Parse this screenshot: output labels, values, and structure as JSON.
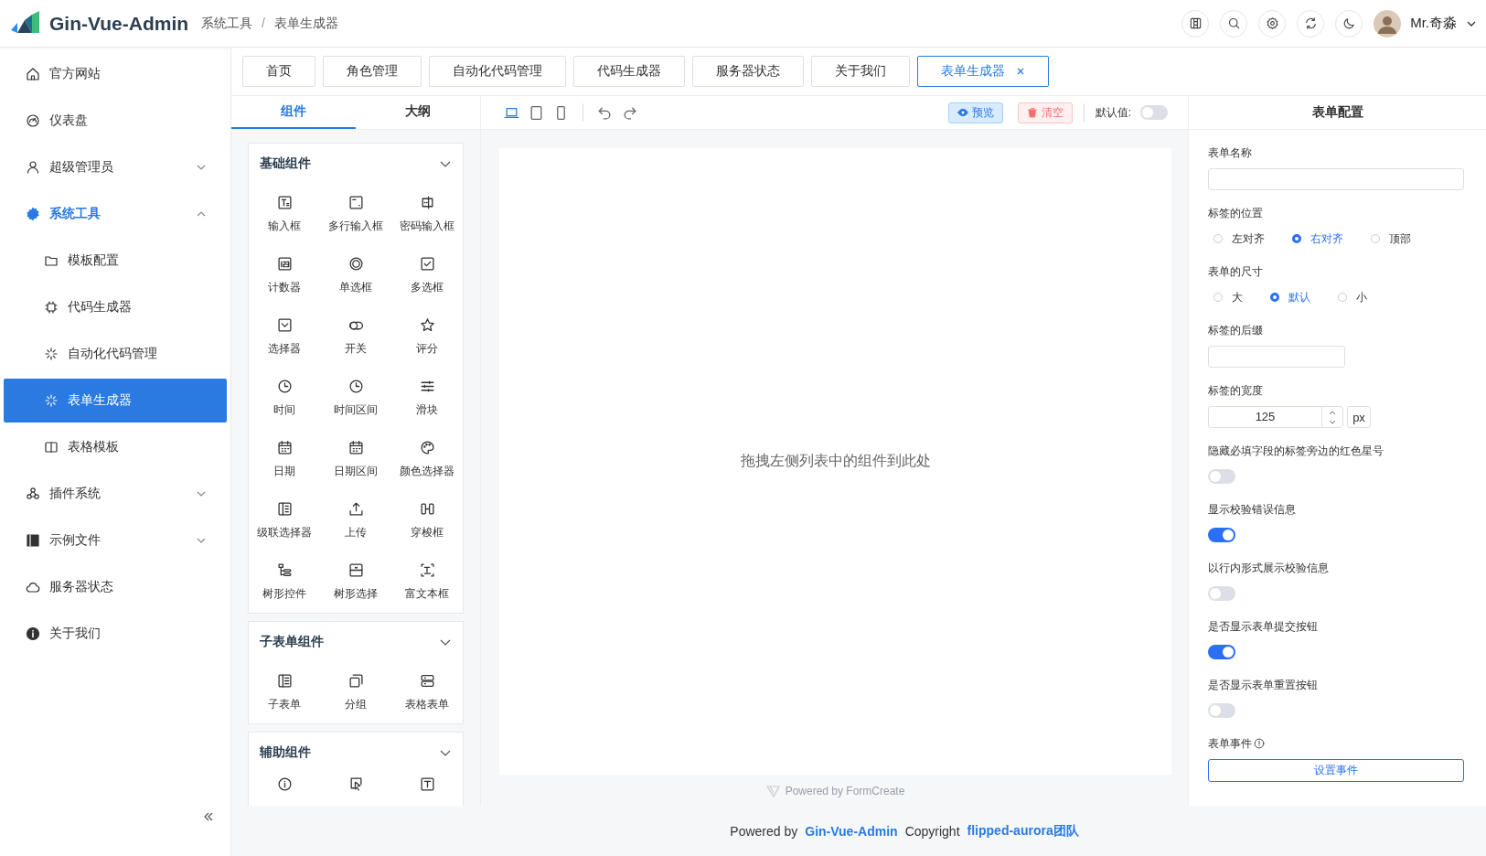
{
  "header": {
    "title": "Gin-Vue-Admin",
    "breadcrumb": [
      "系统工具",
      "表单生成器"
    ],
    "breadcrumb_separator": "/",
    "user_name": "Mr.奇淼"
  },
  "sidebar": {
    "items": [
      {
        "label": "官方网站",
        "selected": false
      },
      {
        "label": "仪表盘",
        "selected": false
      },
      {
        "label": "超级管理员",
        "selected": false,
        "expanded": false
      },
      {
        "label": "系统工具",
        "selected": false,
        "expanded": true,
        "children": [
          {
            "label": "模板配置",
            "selected": false
          },
          {
            "label": "代码生成器",
            "selected": false
          },
          {
            "label": "自动化代码管理",
            "selected": false
          },
          {
            "label": "表单生成器",
            "selected": true
          },
          {
            "label": "表格模板",
            "selected": false
          }
        ]
      },
      {
        "label": "插件系统",
        "selected": false,
        "expanded": false
      },
      {
        "label": "示例文件",
        "selected": false,
        "expanded": false
      },
      {
        "label": "服务器状态",
        "selected": false
      },
      {
        "label": "关于我们",
        "selected": false
      }
    ]
  },
  "tabs": [
    {
      "label": "首页",
      "selected": false
    },
    {
      "label": "角色管理",
      "selected": false
    },
    {
      "label": "自动化代码管理",
      "selected": false
    },
    {
      "label": "代码生成器",
      "selected": false
    },
    {
      "label": "服务器状态",
      "selected": false
    },
    {
      "label": "关于我们",
      "selected": false
    },
    {
      "label": "表单生成器",
      "selected": true,
      "closable": true
    }
  ],
  "builder": {
    "panel_tabs": [
      {
        "label": "组件",
        "selected": true
      },
      {
        "label": "大纲",
        "selected": false
      }
    ],
    "groups": [
      {
        "title": "基础组件",
        "expanded": true,
        "items": [
          {
            "label": "输入框"
          },
          {
            "label": "多行输入框"
          },
          {
            "label": "密码输入框"
          },
          {
            "label": "计数器"
          },
          {
            "label": "单选框"
          },
          {
            "label": "多选框"
          },
          {
            "label": "选择器"
          },
          {
            "label": "开关"
          },
          {
            "label": "评分"
          },
          {
            "label": "时间"
          },
          {
            "label": "时间区间"
          },
          {
            "label": "滑块"
          },
          {
            "label": "日期"
          },
          {
            "label": "日期区间"
          },
          {
            "label": "颜色选择器"
          },
          {
            "label": "级联选择器"
          },
          {
            "label": "上传"
          },
          {
            "label": "穿梭框"
          },
          {
            "label": "树形控件"
          },
          {
            "label": "树形选择"
          },
          {
            "label": "富文本框"
          }
        ]
      },
      {
        "title": "子表单组件",
        "expanded": true,
        "items": [
          {
            "label": "子表单"
          },
          {
            "label": "分组"
          },
          {
            "label": "表格表单"
          }
        ]
      },
      {
        "title": "辅助组件",
        "expanded": true,
        "items": [
          {
            "kind": "icon"
          },
          {
            "kind": "icon"
          },
          {
            "kind": "icon"
          }
        ]
      }
    ],
    "devices": [
      {
        "kind": "desktop",
        "selected": true
      },
      {
        "kind": "tablet",
        "selected": false
      },
      {
        "kind": "phone",
        "selected": false
      }
    ],
    "preview_button": "预览",
    "clear_button": "清空",
    "default_value_label": "默认值:",
    "default_value_on": false,
    "canvas_placeholder": "拖拽左侧列表中的组件到此处",
    "canvas_footer": "Powered by FormCreate"
  },
  "config": {
    "title": "表单配置",
    "fields": [
      {
        "kind": "text",
        "label": "表单名称"
      },
      {
        "kind": "radio",
        "label": "标签的位置",
        "options": [
          {
            "label": "左对齐",
            "selected": false
          },
          {
            "label": "右对齐",
            "selected": true
          },
          {
            "label": "顶部",
            "selected": false
          }
        ]
      },
      {
        "kind": "radio",
        "label": "表单的尺寸",
        "options": [
          {
            "label": "大",
            "selected": false
          },
          {
            "label": "默认",
            "selected": true
          },
          {
            "label": "小",
            "selected": false
          }
        ]
      },
      {
        "kind": "short-text",
        "label": "标签的后缀"
      },
      {
        "kind": "number",
        "label": "标签的宽度",
        "value": "125",
        "suffix": "px"
      },
      {
        "kind": "switch",
        "label": "隐藏必填字段的标签旁边的红色星号",
        "on": false
      },
      {
        "kind": "switch",
        "label": "显示校验错误信息",
        "on": true
      },
      {
        "kind": "switch",
        "label": "以行内形式展示校验信息",
        "on": false
      },
      {
        "kind": "switch",
        "label": "是否显示表单提交按钮",
        "on": true
      },
      {
        "kind": "switch",
        "label": "是否显示表单重置按钮",
        "on": false
      },
      {
        "kind": "event",
        "label": "表单事件",
        "button": "设置事件"
      }
    ]
  },
  "footer": [
    {
      "kind": "text",
      "text": "Powered by"
    },
    {
      "kind": "link",
      "text": "Gin-Vue-Admin"
    },
    {
      "kind": "text",
      "text": "Copyright"
    },
    {
      "kind": "link",
      "text": "flipped-aurora团队"
    }
  ]
}
